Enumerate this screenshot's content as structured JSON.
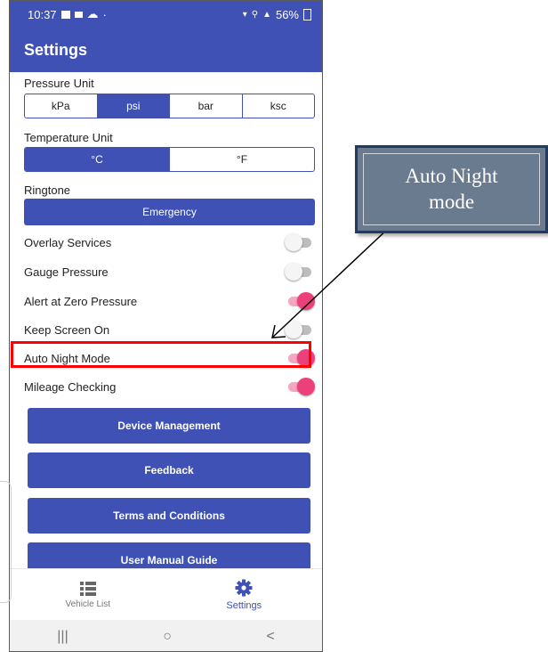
{
  "status_bar": {
    "time": "10:37",
    "battery": "56%"
  },
  "app_bar": {
    "title": "Settings"
  },
  "pressure_unit": {
    "label": "Pressure Unit",
    "options": [
      "kPa",
      "psi",
      "bar",
      "ksc"
    ],
    "selected": "psi"
  },
  "temperature_unit": {
    "label": "Temperature Unit",
    "options": [
      "°C",
      "°F"
    ],
    "selected": "°C"
  },
  "ringtone": {
    "label": "Ringtone",
    "value": "Emergency"
  },
  "toggles": [
    {
      "label": "Overlay Services",
      "on": false
    },
    {
      "label": "Gauge Pressure",
      "on": false
    },
    {
      "label": "Alert at Zero Pressure",
      "on": true
    },
    {
      "label": "Keep Screen On",
      "on": false
    },
    {
      "label": "Auto Night Mode",
      "on": true
    },
    {
      "label": "Mileage Checking",
      "on": true
    }
  ],
  "buttons": [
    "Device Management",
    "Feedback",
    "Terms and Conditions",
    "User Manual Guide"
  ],
  "bottom_nav": [
    {
      "label": "Vehicle List",
      "icon": "list-icon",
      "active": false
    },
    {
      "label": "Settings",
      "icon": "gear-icon",
      "active": true
    }
  ],
  "system_nav": {
    "recents": "|||",
    "home": "○",
    "back": "<"
  },
  "callout": {
    "line1": "Auto Night",
    "line2": "mode"
  },
  "colors": {
    "primary": "#3f51b5",
    "switch_on": "#ec407a",
    "highlight": "#ff0000",
    "callout_fill": "#6b7b8f"
  }
}
